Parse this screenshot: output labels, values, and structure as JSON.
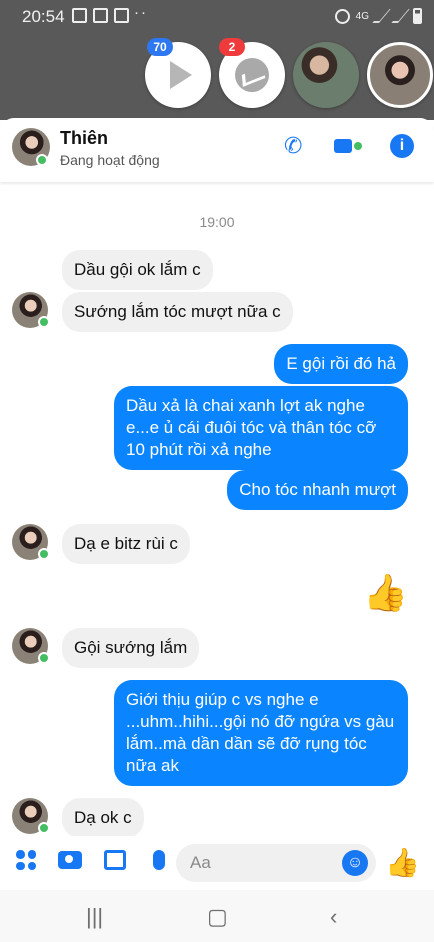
{
  "status_bar": {
    "time": "20:54",
    "network": "4G",
    "left_icons": [
      "tiktok-icon",
      "facebook-icon",
      "app-icon"
    ],
    "right_icons": [
      "alarm-icon",
      "signal-icon",
      "battery-icon"
    ]
  },
  "chat_heads": [
    {
      "type": "video-app",
      "badge": "70"
    },
    {
      "type": "messenger",
      "badge": "2"
    },
    {
      "type": "photo"
    },
    {
      "type": "photo"
    }
  ],
  "header": {
    "name": "Thiên",
    "status": "Đang hoạt động",
    "actions": [
      "phone-icon",
      "video-call-icon",
      "info-icon"
    ]
  },
  "chat": {
    "timestamp": "19:00",
    "messages": [
      {
        "dir": "in",
        "text": "Dầu gội ok lắm c"
      },
      {
        "dir": "in",
        "text": "Sướng lắm tóc mượt nữa c"
      },
      {
        "dir": "out",
        "text": "E gội rồi đó hả"
      },
      {
        "dir": "out",
        "text": "Dầu xả là chai xanh lợt ak nghe e...e ủ cái đuôi tóc và thân tóc cỡ 10 phút rồi xả nghe"
      },
      {
        "dir": "out",
        "text": "Cho tóc nhanh mượt"
      },
      {
        "dir": "in",
        "text": "Dạ e bitz rùi c"
      },
      {
        "dir": "out",
        "type": "like"
      },
      {
        "dir": "in",
        "text": "Gội sướng lắm"
      },
      {
        "dir": "out",
        "text": "Giới thịu giúp c vs nghe e ...uhm..hihi...gội nó đỡ ngứa vs gàu lắm..mà dần dần sẽ đỡ rụng tóc nữa ak"
      },
      {
        "dir": "in",
        "text": "Dạ ok c"
      }
    ]
  },
  "composer": {
    "placeholder": "Aa",
    "icons": [
      "menu-grid-icon",
      "camera-icon",
      "gallery-icon",
      "mic-icon",
      "emoji-icon",
      "like-icon"
    ]
  },
  "colors": {
    "accent": "#1877f2",
    "bubble_out": "#0a84ff",
    "bubble_in": "#f0f0f0",
    "online": "#45bd62"
  }
}
